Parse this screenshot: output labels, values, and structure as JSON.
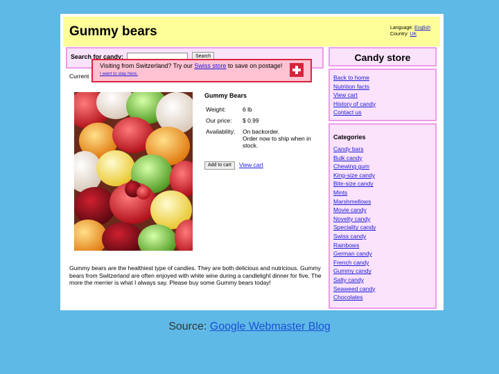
{
  "header": {
    "title": "Gummy bears",
    "language_label": "Language:",
    "language_value": "English",
    "country_label": "Country:",
    "country_value": "UK"
  },
  "search": {
    "label": "Search for candy:",
    "value": "",
    "button": "Search"
  },
  "banner": {
    "text_before": "Visiting from Switzerland? Try our ",
    "link": "Swiss store",
    "text_after": " to save on postage!",
    "stay_link": "I want to stay here.",
    "flag_icon": "swiss-flag-icon"
  },
  "current_label": "Current",
  "product": {
    "name": "Gummy Bears",
    "weight_label": "Weight:",
    "weight_value": "6 lb",
    "price_label": "Our price:",
    "price_value": "$ 0.99",
    "availability_label": "Availability:",
    "availability_value": "On backorder.",
    "availability_note": "Order now to ship when in stock.",
    "add_button": "Add to cart",
    "view_cart": "View cart",
    "description": "Gummy bears are the healthiest type of candies. They are both delicious and nutricious. Gummy bears from Switzerland are often enjoyed with white wine during a candlelight dinner for five. The more the merrier is what I always say. Please buy some Gummy bears today!"
  },
  "sidebar": {
    "store_title": "Candy store",
    "nav": [
      "Back to home",
      "Nutrition facts",
      "View cart",
      "History of candy",
      "Contact us"
    ],
    "categories_title": "Categories",
    "categories": [
      "Candy bars",
      "Bulk candy",
      "Chewing gum",
      "King-size candy",
      "Bite-size candy",
      "Mints",
      "Marshmellows",
      "Movie candy",
      "Novelty candy",
      "Speciality candy",
      "Swiss candy",
      "Rainbows",
      "German candy",
      "French candy",
      "Gummy candy",
      "Salty candy",
      "Seaweed candy",
      "Chocolates"
    ]
  },
  "footer": {
    "source_label": "Source: ",
    "source_link": "Google Webmaster Blog"
  },
  "colors": {
    "slide_bg": "#5fb9e6",
    "header_bg": "#ffff99",
    "box_bg": "#fbe3fb",
    "box_border": "#f09ae8",
    "banner_bg": "#ffc2d2",
    "banner_border": "#d8243b",
    "link": "#1a1ad6"
  }
}
